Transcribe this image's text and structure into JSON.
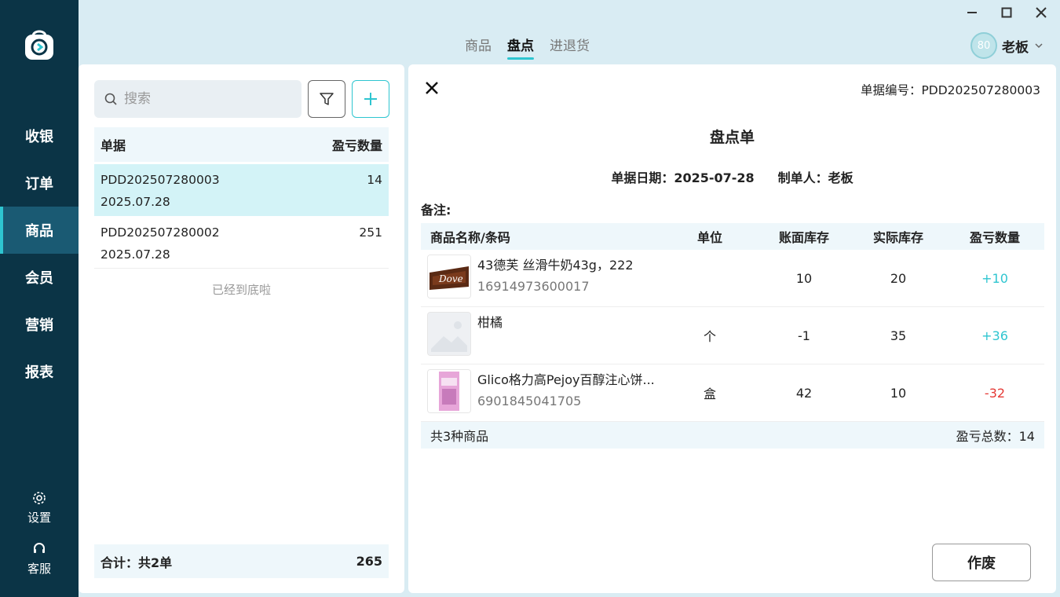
{
  "sidebar": {
    "nav": [
      {
        "label": "收银"
      },
      {
        "label": "订单"
      },
      {
        "label": "商品"
      },
      {
        "label": "会员"
      },
      {
        "label": "营销"
      },
      {
        "label": "报表"
      }
    ],
    "active": "商品",
    "settings_label": "设置",
    "service_label": "客服"
  },
  "top": {
    "tabs": [
      "商品",
      "盘点",
      "进退货"
    ],
    "active_tab": "盘点",
    "user": {
      "avatar_text": "80",
      "name": "老板"
    }
  },
  "list": {
    "search_placeholder": "搜索",
    "header_doc": "单据",
    "header_qty": "盈亏数量",
    "rows": [
      {
        "id": "PDD202507280003",
        "date": "2025.07.28",
        "qty": "14"
      },
      {
        "id": "PDD202507280002",
        "date": "2025.07.28",
        "qty": "251"
      }
    ],
    "end_text": "已经到底啦",
    "total_label": "合计：共2单",
    "total_value": "265"
  },
  "detail": {
    "doc_no": "单据编号：PDD202507280003",
    "title": "盘点单",
    "date": "单据日期：2025-07-28",
    "maker": "制单人：老板",
    "note": "备注:",
    "columns": [
      "商品名称/条码",
      "单位",
      "账面库存",
      "实际库存",
      "盈亏数量"
    ],
    "items": [
      {
        "name": "43德芙 丝滑牛奶43g，222",
        "barcode": "16914973600017",
        "unit": "",
        "book": "10",
        "actual": "20",
        "diff": "+10",
        "thumb": "dove-chocolate-image"
      },
      {
        "name": "柑橘",
        "barcode": "",
        "unit": "个",
        "book": "-1",
        "actual": "35",
        "diff": "+36",
        "thumb": "placeholder-image-icon"
      },
      {
        "name": "Glico格力高Pejoy百醇注心饼...",
        "barcode": "6901845041705",
        "unit": "盒",
        "book": "42",
        "actual": "10",
        "diff": "-32",
        "thumb": "glico-pejoy-image"
      }
    ],
    "footer_count": "共3种商品",
    "footer_total": "盈亏总数：14",
    "void_label": "作废"
  },
  "colors": {
    "sidebar": "#0b3446",
    "accent": "#2ec5d0",
    "negative": "#e53935"
  }
}
